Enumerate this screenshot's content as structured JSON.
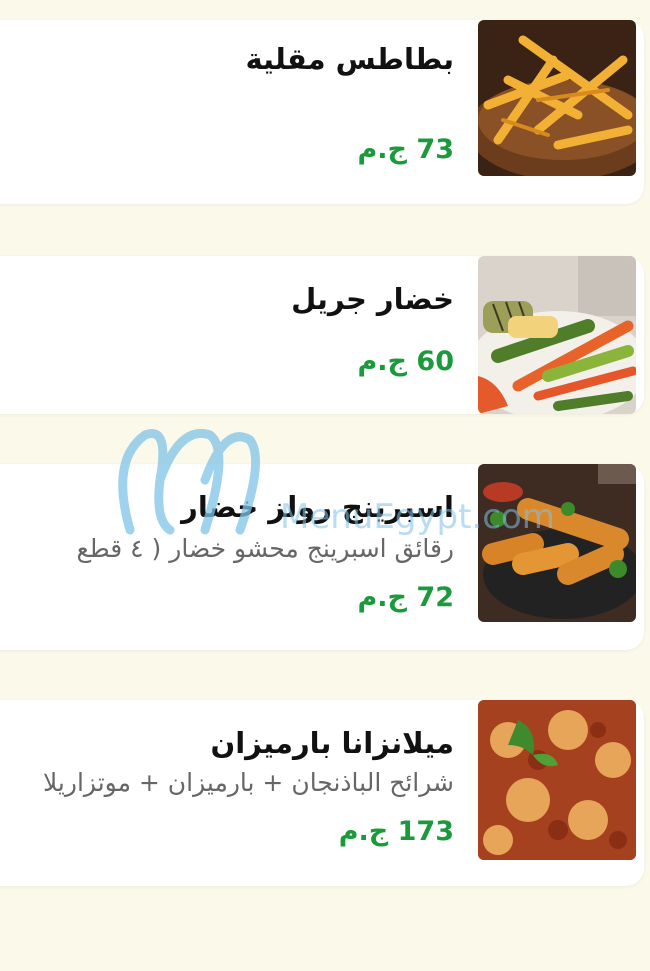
{
  "theme": {
    "price_color": "#1b9a3c",
    "page_bg": "#fbf9ea"
  },
  "items": [
    {
      "title": "بطاطس مقلية",
      "description": "",
      "price": "73 ج.م",
      "image": "fries-photo"
    },
    {
      "title": "خضار جريل",
      "description": "",
      "price": "60 ج.م",
      "image": "grilled-vegetables-photo"
    },
    {
      "title": "اسبرينج رولز خضار",
      "description": "رقائق اسبرينج محشو خضار ( ٤ قطع",
      "price": "72 ج.م",
      "image": "spring-rolls-photo"
    },
    {
      "title": "ميلانزانا بارميزان",
      "description": "شرائح الباذنجان + بارميزان + موتزاريلا",
      "price": "173 ج.م",
      "image": "eggplant-parmesan-photo"
    }
  ],
  "watermark": {
    "text": "MenuEgypt.com"
  }
}
